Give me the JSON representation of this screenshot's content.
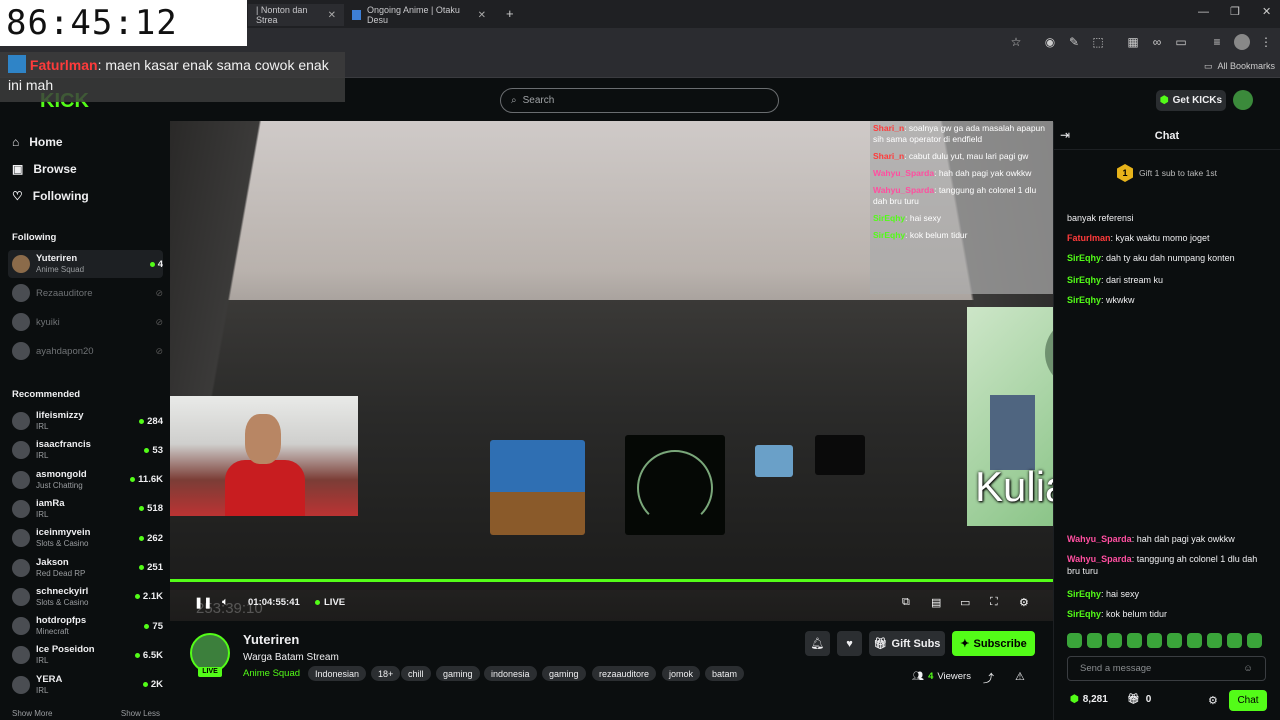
{
  "browser": {
    "tabs": [
      {
        "label": "| Nonton dan Strea"
      },
      {
        "label": "Ongoing Anime | Otaku Desu"
      }
    ],
    "new_tab": "+",
    "bookmarks_label": "All Bookmarks"
  },
  "overlay": {
    "clock": "86:45:12",
    "chat_user": "Faturlman",
    "chat_text": ": maen kasar enak sama cowok enak ini mah"
  },
  "header": {
    "search_placeholder": "Search",
    "get_kicks": "Get KICKs"
  },
  "sidebar": {
    "nav": [
      {
        "label": "Home",
        "icon": "home-icon"
      },
      {
        "label": "Browse",
        "icon": "browse-icon"
      },
      {
        "label": "Following",
        "icon": "heart-icon"
      }
    ],
    "following_title": "Following",
    "following": [
      {
        "name": "Yuteriren",
        "category": "Anime Squad",
        "viewers": "4",
        "live": true
      },
      {
        "name": "Rezaauditore",
        "live": false
      },
      {
        "name": "kyuiki",
        "live": false
      },
      {
        "name": "ayahdapon20",
        "live": false
      }
    ],
    "recommended_title": "Recommended",
    "recommended": [
      {
        "name": "lifeismizzy",
        "category": "IRL",
        "viewers": "284"
      },
      {
        "name": "isaacfrancis",
        "category": "IRL",
        "viewers": "53"
      },
      {
        "name": "asmongold",
        "category": "Just Chatting",
        "viewers": "11.6K"
      },
      {
        "name": "iamRa",
        "category": "IRL",
        "viewers": "518"
      },
      {
        "name": "iceinmyvein",
        "category": "Slots & Casino",
        "viewers": "262"
      },
      {
        "name": "Jakson",
        "category": "Red Dead RP",
        "viewers": "251"
      },
      {
        "name": "schneckyirl",
        "category": "Slots & Casino",
        "viewers": "2.1K"
      },
      {
        "name": "hotdropfps",
        "category": "Minecraft",
        "viewers": "75"
      },
      {
        "name": "Ice Poseidon",
        "category": "IRL",
        "viewers": "6.5K"
      },
      {
        "name": "YERA",
        "category": "IRL",
        "viewers": "2K"
      }
    ],
    "show_more": "Show More",
    "show_less": "Show Less"
  },
  "video": {
    "overlay_text": "Kuliah Onleng",
    "ghost_time": "253:39:10",
    "time": "01:04:55:41",
    "live_label": "LIVE",
    "progress": 1.0,
    "in_video_chat": [
      {
        "user": "Shari_n",
        "text": ": soalnya gw ga ada masalah apapun sih sama operator di endfield"
      },
      {
        "user": "Shari_n",
        "text": ": cabut dulu yut, mau lari pagi gw"
      },
      {
        "user": "Wahyu_Sparda",
        "text": ": hah dah pagi yak owkkw"
      },
      {
        "user": "Wahyu_Sparda",
        "text": ": tanggung ah colonel 1 dlu dah bru turu"
      },
      {
        "user": "SirEqhy",
        "text": ": hai sexy"
      },
      {
        "user": "SirEqhy",
        "text": ": kok belum tidur"
      }
    ]
  },
  "stream": {
    "name": "Yuteriren",
    "title": "Warga Batam Stream",
    "category": "Anime Squad",
    "live_badge": "LIVE",
    "tags": [
      "Indonesian",
      "18+",
      "chill",
      "gaming",
      "indonesia",
      "gaming",
      "rezaauditore",
      "jomok",
      "batam"
    ],
    "gift_subs": "Gift Subs",
    "subscribe": "Subscribe",
    "viewers_count": "4",
    "viewers_label": "Viewers"
  },
  "chat": {
    "title": "Chat",
    "gift_prompt": "Gift 1 sub to take 1st",
    "gift_rank": "1",
    "messages_top": [
      {
        "user": "",
        "text": "banyak referensi"
      },
      {
        "user": "Faturlman",
        "text": ": kyak waktu momo joget",
        "color": "r"
      },
      {
        "user": "SirEqhy",
        "text": ": dah ty aku dah numpang konten",
        "color": "g"
      },
      {
        "user": "SirEqhy",
        "text": ": dari stream ku",
        "color": "g"
      },
      {
        "user": "SirEqhy",
        "text": ": wkwkw",
        "color": "g"
      }
    ],
    "messages_bottom": [
      {
        "user": "Wahyu_Sparda",
        "text": ": hah dah pagi yak owkkw",
        "color": "p"
      },
      {
        "user": "Wahyu_Sparda",
        "text": ": tanggung ah colonel 1 dlu dah bru turu",
        "color": "p"
      },
      {
        "user": "SirEqhy",
        "text": ": hai sexy",
        "color": "g"
      },
      {
        "user": "SirEqhy",
        "text": ": kok belum tidur",
        "color": "g"
      }
    ],
    "input_placeholder": "Send a message",
    "points": "8,281",
    "gifts": "0",
    "chat_button": "Chat"
  }
}
